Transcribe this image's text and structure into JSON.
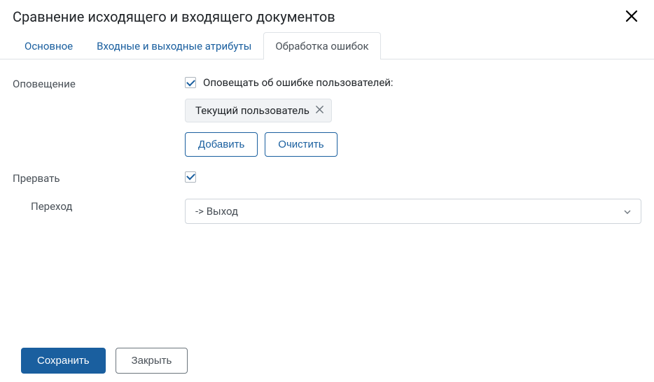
{
  "header": {
    "title": "Сравнение исходящего и входящего документов"
  },
  "tabs": [
    {
      "label": "Основное",
      "active": false
    },
    {
      "label": "Входные и выходные атрибуты",
      "active": false
    },
    {
      "label": "Обработка ошибок",
      "active": true
    }
  ],
  "form": {
    "notification": {
      "label": "Оповещение",
      "checkbox_label": "Оповещать об ошибке пользователей:",
      "checked": true,
      "chips": [
        {
          "label": "Текущий пользователь"
        }
      ]
    },
    "buttons": {
      "add": "Добавить",
      "clear": "Очистить"
    },
    "interrupt": {
      "label": "Прервать",
      "checked": true
    },
    "transition": {
      "label": "Переход",
      "value": "-> Выход"
    }
  },
  "footer": {
    "save": "Сохранить",
    "close": "Закрыть"
  }
}
